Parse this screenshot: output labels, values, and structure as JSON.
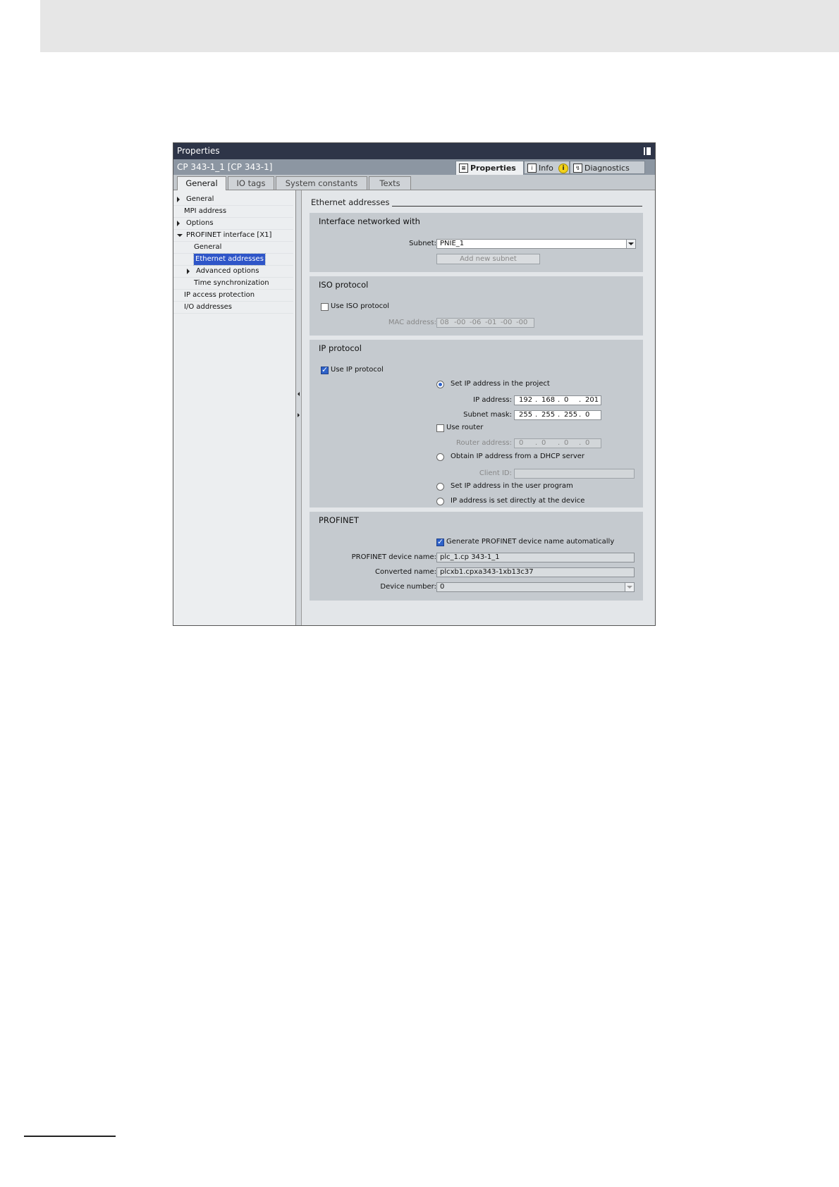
{
  "window": {
    "title": "Properties",
    "object": "CP 343-1_1 [CP 343-1]",
    "right_tabs": [
      "Properties",
      "Info",
      "Diagnostics"
    ],
    "tabs": [
      "General",
      "IO tags",
      "System constants",
      "Texts"
    ]
  },
  "tree": [
    {
      "label": "General",
      "twisty": "right"
    },
    {
      "label": "MPI address",
      "twisty": ""
    },
    {
      "label": "Options",
      "twisty": "right"
    },
    {
      "label": "PROFINET interface [X1]",
      "twisty": "down"
    },
    {
      "label": "General",
      "twisty": ""
    },
    {
      "label": "Ethernet addresses",
      "twisty": "",
      "selected": true
    },
    {
      "label": "Advanced options",
      "twisty": "right"
    },
    {
      "label": "Time synchronization",
      "twisty": ""
    },
    {
      "label": "IP access protection",
      "twisty": ""
    },
    {
      "label": "I/O addresses",
      "twisty": ""
    }
  ],
  "content": {
    "heading": "Ethernet addresses",
    "interface": {
      "title": "Interface networked with",
      "subnet_label": "Subnet:",
      "subnet_value": "PNIE_1",
      "add_subnet": "Add new subnet"
    },
    "iso": {
      "title": "ISO protocol",
      "use_label": "Use ISO protocol",
      "use_checked": false,
      "mac_label": "MAC address:",
      "mac": [
        "08",
        "-00",
        "-06",
        "-01",
        "-00",
        "-00"
      ]
    },
    "ip": {
      "title": "IP protocol",
      "use_label": "Use IP protocol",
      "use_checked": true,
      "opt_project": "Set IP address in the project",
      "ip_label": "IP address:",
      "ip": [
        "192",
        ".",
        "168",
        ".",
        "0",
        ".",
        "201"
      ],
      "mask_label": "Subnet mask:",
      "mask": [
        "255",
        ".",
        "255",
        ".",
        "255",
        ".",
        "0"
      ],
      "router_label": "Use router",
      "router_addr_label": "Router address:",
      "router": [
        "0",
        ".",
        "0",
        ".",
        "0",
        ".",
        "0"
      ],
      "opt_dhcp": "Obtain IP address from a DHCP server",
      "client_label": "Client ID:",
      "opt_user": "Set IP address in the user program",
      "opt_device": "IP address is set directly at the device"
    },
    "profinet": {
      "title": "PROFINET",
      "auto_label": "Generate PROFINET device name automatically",
      "auto_checked": true,
      "name_label": "PROFINET device name:",
      "name_value": "plc_1.cp 343-1_1",
      "conv_label": "Converted name:",
      "conv_value": "plcxb1.cpxa343-1xb13c37",
      "num_label": "Device number:",
      "num_value": "0"
    }
  }
}
